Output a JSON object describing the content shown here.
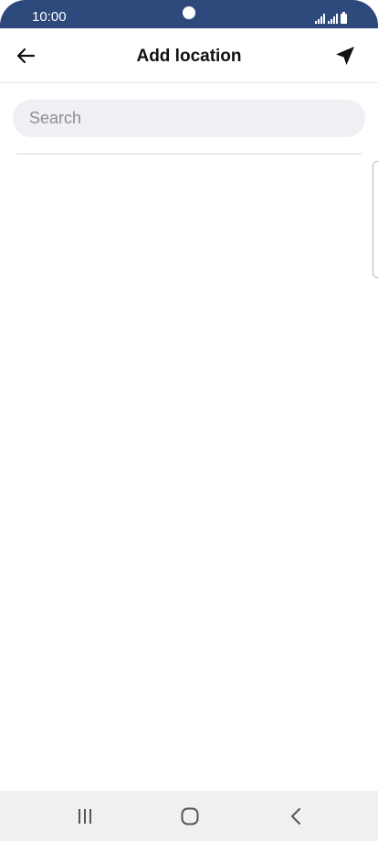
{
  "status_bar": {
    "time": "10:00",
    "background_color": "#2e4a7d"
  },
  "header": {
    "title": "Add location",
    "back_icon": "arrow-left-icon",
    "action_icon": "navigation-arrow-icon"
  },
  "search": {
    "placeholder": "Search",
    "value": ""
  },
  "nav_bar": {
    "recents_icon": "recent-apps-icon",
    "home_icon": "home-icon",
    "back_icon": "back-chevron-icon"
  }
}
